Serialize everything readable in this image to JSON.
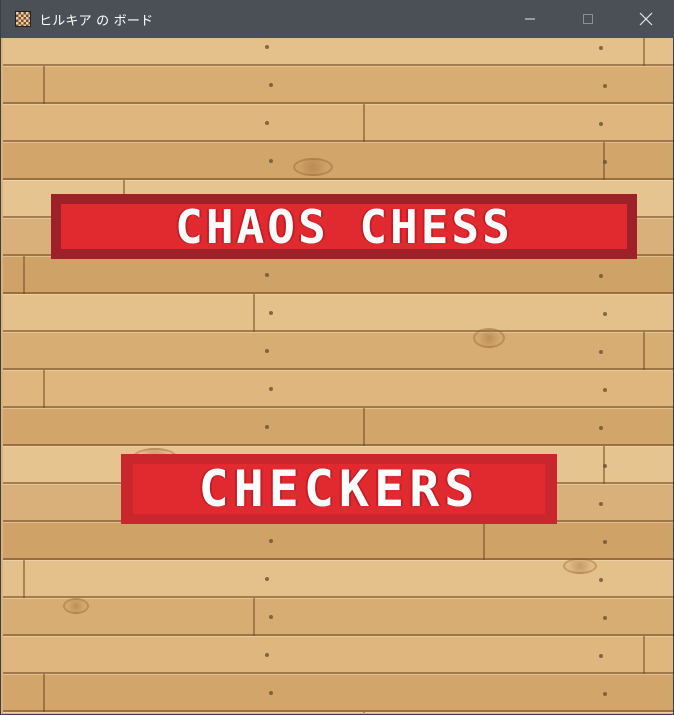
{
  "window": {
    "title": "ヒルキア の ボード",
    "app_icon": "checkerboard-icon",
    "controls": {
      "minimize_icon": "minimize-icon",
      "maximize_icon": "maximize-icon",
      "close_icon": "close-icon"
    }
  },
  "board": {
    "background": "wood-planks",
    "colors": {
      "wood": "#d9b27c",
      "titlebar": "#4a5055",
      "button_dark": "#9e2028",
      "button_red": "#e12a30",
      "button_text": "#ffffff"
    }
  },
  "menu": {
    "chaos_chess_label": "CHAOS CHESS",
    "checkers_label": "CHECKERS"
  }
}
